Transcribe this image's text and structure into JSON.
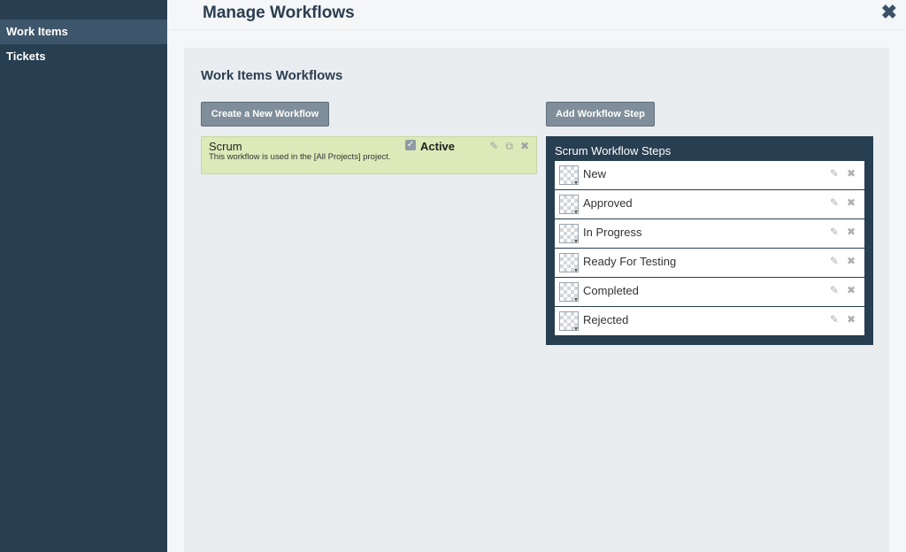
{
  "sidebar": {
    "items": [
      {
        "label": "Work Items",
        "active": true
      },
      {
        "label": "Tickets",
        "active": false
      }
    ]
  },
  "header": {
    "title": "Manage Workflows",
    "close_icon": "close-icon"
  },
  "main": {
    "section_title": "Work Items Workflows",
    "create_button": "Create a New Workflow",
    "add_step_button": "Add Workflow Step",
    "workflow": {
      "name": "Scrum",
      "description": "This workflow is used in the [All Projects] project.",
      "active_label": "Active",
      "active": true,
      "card_color": "#dbeab8"
    },
    "steps_panel": {
      "title": "Scrum Workflow Steps",
      "steps": [
        {
          "label": "New"
        },
        {
          "label": "Approved"
        },
        {
          "label": "In Progress"
        },
        {
          "label": "Ready For Testing"
        },
        {
          "label": "Completed"
        },
        {
          "label": "Rejected"
        }
      ]
    }
  },
  "colors": {
    "sidebar": "#283e51",
    "sidebar_active": "#3e566b",
    "button": "#7f8e9a",
    "panel": "#e9edf0"
  }
}
